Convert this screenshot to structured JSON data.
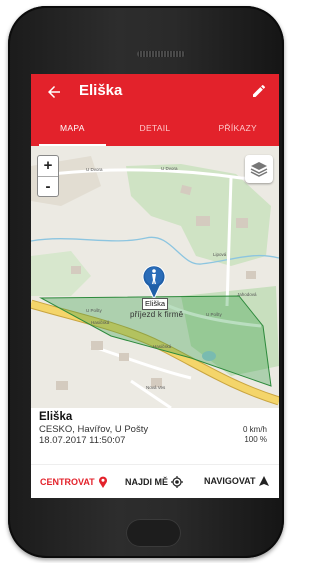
{
  "header": {
    "title": "Eliška",
    "tabs": [
      "MAPA",
      "DETAIL",
      "PŘÍKAZY"
    ]
  },
  "map": {
    "pin_label": "Eliška",
    "place_label": "příjezd k firmě",
    "streets": [
      "U Dvora",
      "U Dvora",
      "U Pošty",
      "U Pošty",
      "Hasičská",
      "Hasičská",
      "Nová Ves",
      "Lipová",
      "Jahodová"
    ],
    "zoom_in": "+",
    "zoom_out": "-"
  },
  "info": {
    "name": "Eliška",
    "address": "CESKO, Havířov, U Pošty",
    "datetime": "18.07.2017 11:50:07",
    "speed": "0 km/h",
    "battery": "100 %"
  },
  "actions": {
    "center": "CENTROVAT",
    "find_me": "NAJDI MĚ",
    "navigate": "NAVIGOVAT"
  },
  "colors": {
    "accent": "#e3222b",
    "geofence": "#3aa04a"
  }
}
